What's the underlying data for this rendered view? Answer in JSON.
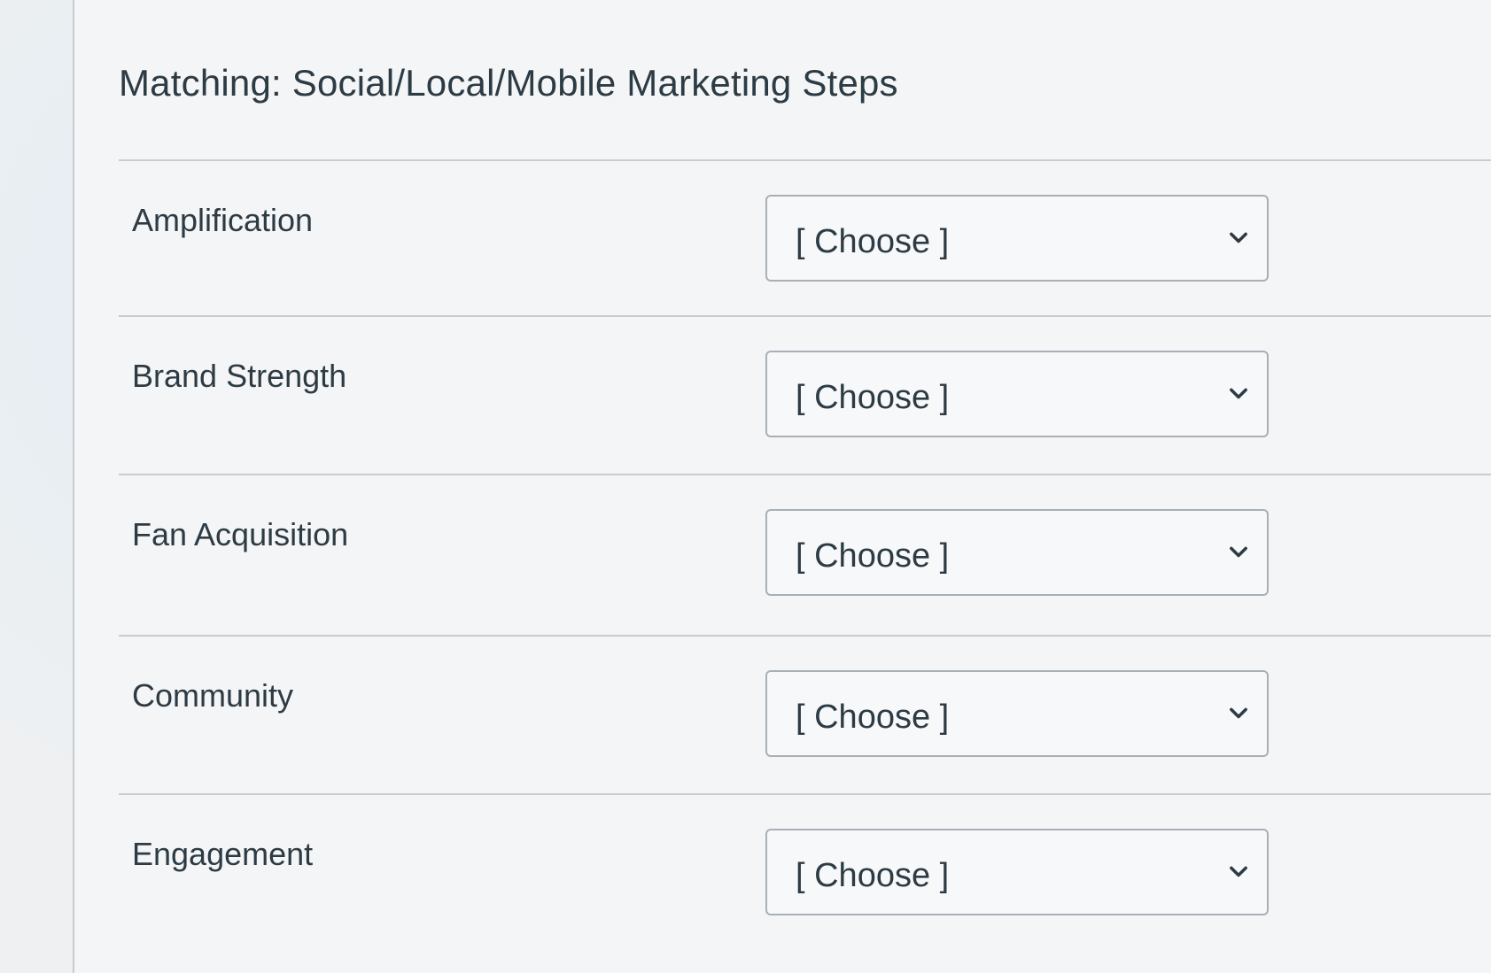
{
  "question": {
    "title": "Matching: Social/Local/Mobile Marketing Steps"
  },
  "rows": [
    {
      "label": "Amplification",
      "selected": "[ Choose ]"
    },
    {
      "label": "Brand Strength",
      "selected": "[ Choose ]"
    },
    {
      "label": "Fan Acquisition",
      "selected": "[ Choose ]"
    },
    {
      "label": "Community",
      "selected": "[ Choose ]"
    },
    {
      "label": "Engagement",
      "selected": "[ Choose ]"
    }
  ],
  "icons": {
    "dropdown": "chevron-down-icon"
  },
  "colors": {
    "text": "#2d3b45",
    "border": "#a7b0b7",
    "divider": "#c7cdd1"
  }
}
